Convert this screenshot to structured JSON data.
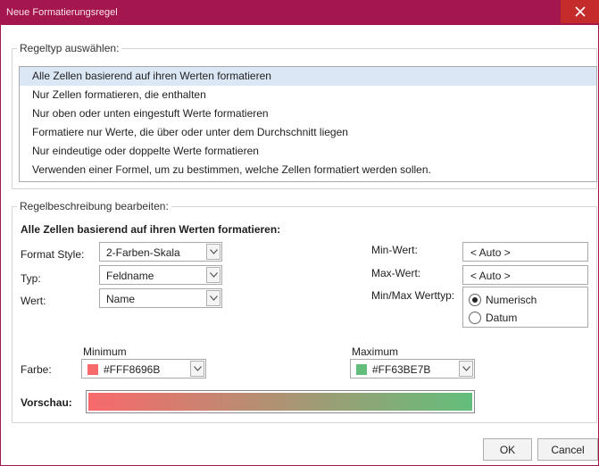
{
  "window": {
    "title": "Neue Formatierungsregel"
  },
  "rule_type": {
    "legend": "Regeltyp auswählen:",
    "items": [
      "Alle Zellen basierend auf ihren Werten formatieren",
      "Nur Zellen formatieren, die enthalten",
      "Nur oben oder unten eingestuft Werte formatieren",
      "Formatiere nur Werte, die über oder unter dem Durchschnitt liegen",
      "Nur eindeutige oder doppelte Werte formatieren",
      "Verwenden einer Formel, um zu bestimmen, welche Zellen formatiert werden sollen."
    ],
    "selected_index": 0
  },
  "description": {
    "legend": "Regelbeschreibung bearbeiten:",
    "heading": "Alle Zellen basierend auf ihren Werten formatieren:",
    "format_style_label": "Format Style:",
    "format_style_value": "2-Farben-Skala",
    "typ_label": "Typ:",
    "typ_value": "Feldname",
    "wert_label": "Wert:",
    "wert_value": "Name",
    "min_label": "Min-Wert:",
    "min_value": "< Auto >",
    "max_label": "Max-Wert:",
    "max_value": "< Auto >",
    "minmax_type_label": "Min/Max Werttyp:",
    "minmax_options": [
      "Numerisch",
      "Datum"
    ],
    "minmax_selected": "Numerisch",
    "minimum_label": "Minimum",
    "maximum_label": "Maximum",
    "farbe_label": "Farbe:",
    "min_color_text": "#FFF8696B",
    "max_color_text": "#FF63BE7B",
    "preview_label": "Vorschau:"
  },
  "colors": {
    "title_bar": "#a3174e",
    "min_color": "#F8696B",
    "max_color": "#63BE7B",
    "selected_row": "#dbe7f5"
  },
  "icons": {
    "close": "close-icon",
    "dropdown": "chevron-down-icon"
  },
  "buttons": {
    "ok": "OK",
    "cancel": "Cancel"
  }
}
